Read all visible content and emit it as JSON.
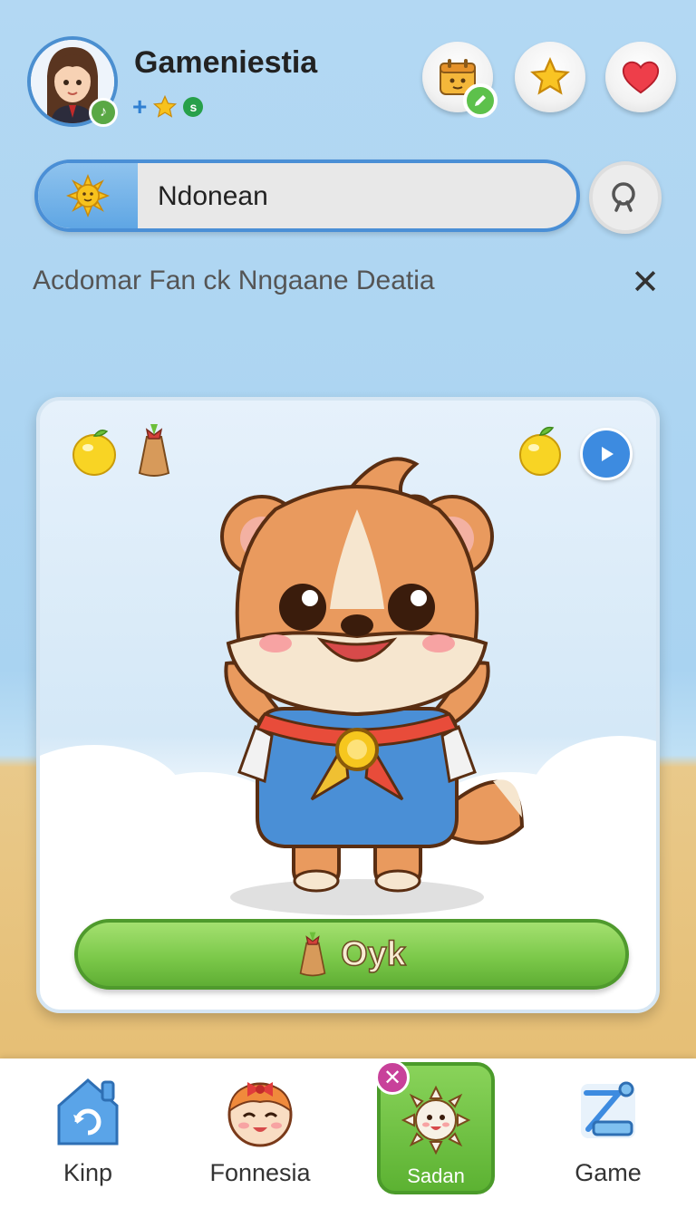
{
  "header": {
    "username": "Gameniestia",
    "status": {
      "plus": "+",
      "coin_label": "s"
    },
    "actions": [
      {
        "name": "calendar-button",
        "icon": "calendar-icon"
      },
      {
        "name": "favorites-button",
        "icon": "star-icon"
      },
      {
        "name": "likes-button",
        "icon": "heart-icon"
      }
    ]
  },
  "search": {
    "value": "Ndonean",
    "chip_icon": "sun-icon",
    "button_icon": "search-icon"
  },
  "banner": {
    "text": "Acdomar Fan ck Nngaane Deatia",
    "close_icon": "close-icon"
  },
  "card": {
    "left_icons": [
      "lemon-icon",
      "pouch-icon"
    ],
    "right_icons": [
      "lemon-icon",
      "play-icon"
    ],
    "mascot": "fox-mascot",
    "action_label": "Oyk",
    "action_icon": "pouch-icon"
  },
  "nav": {
    "items": [
      {
        "label": "Kinp",
        "icon": "home-refresh-icon"
      },
      {
        "label": "Fonnesia",
        "icon": "girl-face-icon"
      },
      {
        "label": "Sadan",
        "icon": "sun-face-icon",
        "active": true
      },
      {
        "label": "Game",
        "icon": "game-tools-icon"
      }
    ]
  },
  "colors": {
    "accent_blue": "#4a8fd6",
    "action_green": "#7cc94a",
    "badge_pink": "#c8419a"
  }
}
